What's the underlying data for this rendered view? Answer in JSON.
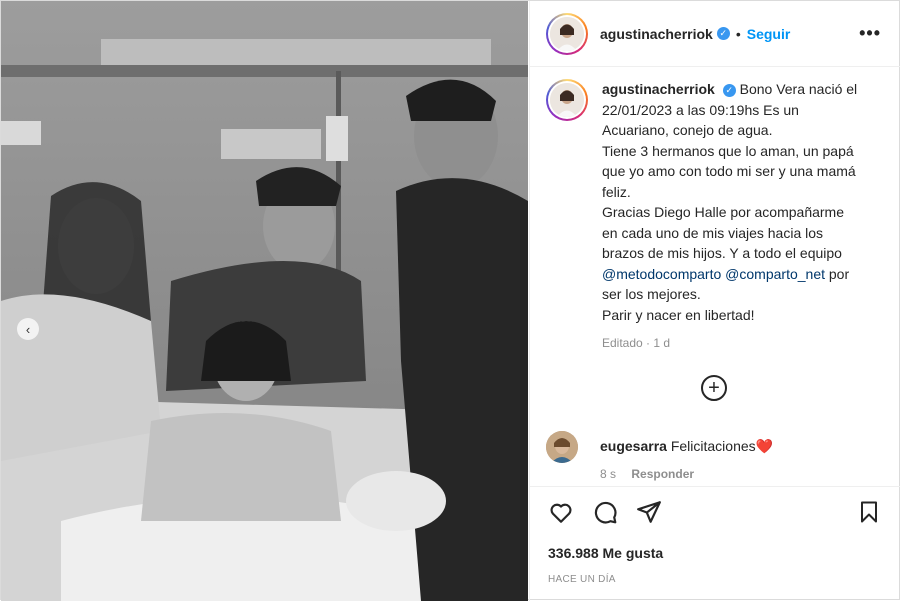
{
  "post": {
    "username": "agustinacherriok",
    "follow_label": "Seguir",
    "more_label": "•••",
    "separator": "•",
    "caption": [
      "Bono Vera nació el 22/01/2023 a las 09:19hs Es un Acuariano, conejo de agua.",
      "Tiene 3 hermanos que lo aman, un papá que yo amo con todo mi ser y una mamá feliz.",
      "Gracias Diego Halle por acompañarme en cada uno de mis viajes hacia los brazos de mis hijos. Y a todo el equipo",
      "@metodocomparto",
      "@comparto_net",
      "por ser los mejores.",
      "Parir y nacer en libertad!"
    ],
    "edited_label": "Editado",
    "edited_time": "1 d",
    "add_label": "+"
  },
  "comment": {
    "username": "eugesarra",
    "text": "Felicitaciones",
    "emoji": "❤️",
    "time": "8 s",
    "reply_label": "Responder"
  },
  "engagement": {
    "likes": "336.988 Me gusta",
    "timestamp": "HACE UN DÍA"
  },
  "icons": {
    "like": "heart-icon",
    "comment": "comment-icon",
    "share": "share-icon",
    "save": "bookmark-icon",
    "verified": "verified-badge-icon",
    "carousel": "chevron-left-icon"
  },
  "colors": {
    "link": "#0095f6",
    "mention": "#00376b",
    "verified": "#3897f0",
    "muted": "#8e8e8e"
  }
}
